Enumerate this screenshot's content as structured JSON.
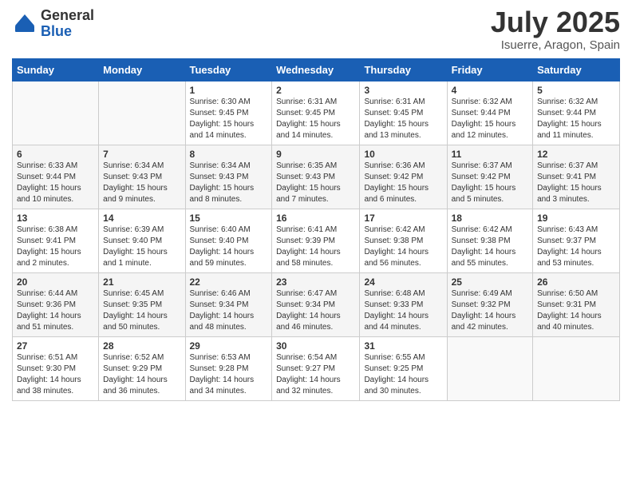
{
  "logo": {
    "general": "General",
    "blue": "Blue"
  },
  "title": {
    "month": "July 2025",
    "location": "Isuerre, Aragon, Spain"
  },
  "weekdays": [
    "Sunday",
    "Monday",
    "Tuesday",
    "Wednesday",
    "Thursday",
    "Friday",
    "Saturday"
  ],
  "weeks": [
    [
      {
        "day": "",
        "info": ""
      },
      {
        "day": "",
        "info": ""
      },
      {
        "day": "1",
        "info": "Sunrise: 6:30 AM\nSunset: 9:45 PM\nDaylight: 15 hours and 14 minutes."
      },
      {
        "day": "2",
        "info": "Sunrise: 6:31 AM\nSunset: 9:45 PM\nDaylight: 15 hours and 14 minutes."
      },
      {
        "day": "3",
        "info": "Sunrise: 6:31 AM\nSunset: 9:45 PM\nDaylight: 15 hours and 13 minutes."
      },
      {
        "day": "4",
        "info": "Sunrise: 6:32 AM\nSunset: 9:44 PM\nDaylight: 15 hours and 12 minutes."
      },
      {
        "day": "5",
        "info": "Sunrise: 6:32 AM\nSunset: 9:44 PM\nDaylight: 15 hours and 11 minutes."
      }
    ],
    [
      {
        "day": "6",
        "info": "Sunrise: 6:33 AM\nSunset: 9:44 PM\nDaylight: 15 hours and 10 minutes."
      },
      {
        "day": "7",
        "info": "Sunrise: 6:34 AM\nSunset: 9:43 PM\nDaylight: 15 hours and 9 minutes."
      },
      {
        "day": "8",
        "info": "Sunrise: 6:34 AM\nSunset: 9:43 PM\nDaylight: 15 hours and 8 minutes."
      },
      {
        "day": "9",
        "info": "Sunrise: 6:35 AM\nSunset: 9:43 PM\nDaylight: 15 hours and 7 minutes."
      },
      {
        "day": "10",
        "info": "Sunrise: 6:36 AM\nSunset: 9:42 PM\nDaylight: 15 hours and 6 minutes."
      },
      {
        "day": "11",
        "info": "Sunrise: 6:37 AM\nSunset: 9:42 PM\nDaylight: 15 hours and 5 minutes."
      },
      {
        "day": "12",
        "info": "Sunrise: 6:37 AM\nSunset: 9:41 PM\nDaylight: 15 hours and 3 minutes."
      }
    ],
    [
      {
        "day": "13",
        "info": "Sunrise: 6:38 AM\nSunset: 9:41 PM\nDaylight: 15 hours and 2 minutes."
      },
      {
        "day": "14",
        "info": "Sunrise: 6:39 AM\nSunset: 9:40 PM\nDaylight: 15 hours and 1 minute."
      },
      {
        "day": "15",
        "info": "Sunrise: 6:40 AM\nSunset: 9:40 PM\nDaylight: 14 hours and 59 minutes."
      },
      {
        "day": "16",
        "info": "Sunrise: 6:41 AM\nSunset: 9:39 PM\nDaylight: 14 hours and 58 minutes."
      },
      {
        "day": "17",
        "info": "Sunrise: 6:42 AM\nSunset: 9:38 PM\nDaylight: 14 hours and 56 minutes."
      },
      {
        "day": "18",
        "info": "Sunrise: 6:42 AM\nSunset: 9:38 PM\nDaylight: 14 hours and 55 minutes."
      },
      {
        "day": "19",
        "info": "Sunrise: 6:43 AM\nSunset: 9:37 PM\nDaylight: 14 hours and 53 minutes."
      }
    ],
    [
      {
        "day": "20",
        "info": "Sunrise: 6:44 AM\nSunset: 9:36 PM\nDaylight: 14 hours and 51 minutes."
      },
      {
        "day": "21",
        "info": "Sunrise: 6:45 AM\nSunset: 9:35 PM\nDaylight: 14 hours and 50 minutes."
      },
      {
        "day": "22",
        "info": "Sunrise: 6:46 AM\nSunset: 9:34 PM\nDaylight: 14 hours and 48 minutes."
      },
      {
        "day": "23",
        "info": "Sunrise: 6:47 AM\nSunset: 9:34 PM\nDaylight: 14 hours and 46 minutes."
      },
      {
        "day": "24",
        "info": "Sunrise: 6:48 AM\nSunset: 9:33 PM\nDaylight: 14 hours and 44 minutes."
      },
      {
        "day": "25",
        "info": "Sunrise: 6:49 AM\nSunset: 9:32 PM\nDaylight: 14 hours and 42 minutes."
      },
      {
        "day": "26",
        "info": "Sunrise: 6:50 AM\nSunset: 9:31 PM\nDaylight: 14 hours and 40 minutes."
      }
    ],
    [
      {
        "day": "27",
        "info": "Sunrise: 6:51 AM\nSunset: 9:30 PM\nDaylight: 14 hours and 38 minutes."
      },
      {
        "day": "28",
        "info": "Sunrise: 6:52 AM\nSunset: 9:29 PM\nDaylight: 14 hours and 36 minutes."
      },
      {
        "day": "29",
        "info": "Sunrise: 6:53 AM\nSunset: 9:28 PM\nDaylight: 14 hours and 34 minutes."
      },
      {
        "day": "30",
        "info": "Sunrise: 6:54 AM\nSunset: 9:27 PM\nDaylight: 14 hours and 32 minutes."
      },
      {
        "day": "31",
        "info": "Sunrise: 6:55 AM\nSunset: 9:25 PM\nDaylight: 14 hours and 30 minutes."
      },
      {
        "day": "",
        "info": ""
      },
      {
        "day": "",
        "info": ""
      }
    ]
  ]
}
